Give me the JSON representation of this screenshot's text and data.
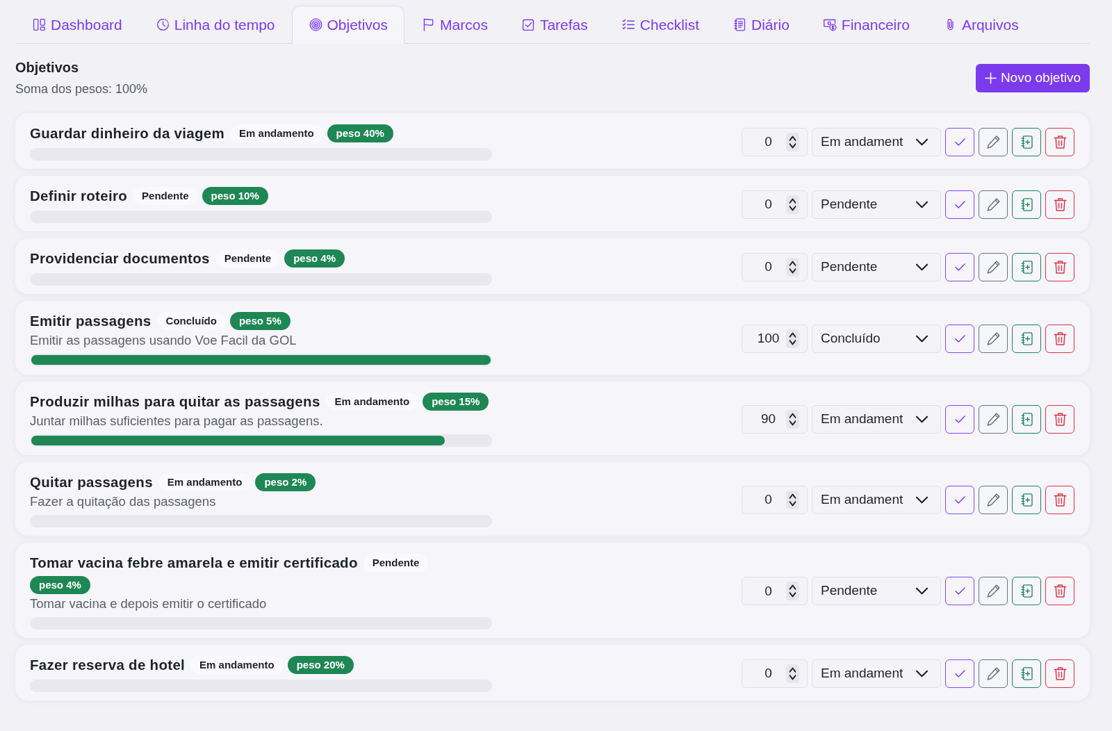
{
  "tabs": [
    {
      "label": "Dashboard",
      "selected": false
    },
    {
      "label": "Linha do tempo",
      "selected": false
    },
    {
      "label": "Objetivos",
      "selected": true
    },
    {
      "label": "Marcos",
      "selected": false
    },
    {
      "label": "Tarefas",
      "selected": false
    },
    {
      "label": "Checklist",
      "selected": false
    },
    {
      "label": "Diário",
      "selected": false
    },
    {
      "label": "Financeiro",
      "selected": false
    },
    {
      "label": "Arquivos",
      "selected": false
    }
  ],
  "header": {
    "title": "Objetivos",
    "subtitle": "Soma dos pesos: 100%",
    "button": "Novo objetivo"
  },
  "objectives": [
    {
      "title": "Guardar dinheiro da viagem",
      "status": "Em andamento",
      "weight": "peso 40%",
      "level": 0,
      "progress": "0",
      "status_select": "Em andament"
    },
    {
      "title": "Definir roteiro",
      "status": "Pendente",
      "weight": "peso 10%",
      "level": 0,
      "progress": "0",
      "status_select": "Pendente"
    },
    {
      "title": "Providenciar documentos",
      "status": "Pendente",
      "weight": "peso 4%",
      "level": 0,
      "progress": "0",
      "status_select": "Pendente"
    },
    {
      "title": "Emitir passagens",
      "status": "Concluído",
      "weight": "peso 5%",
      "description": "Emitir as passagens usando Voe Facil da GOL",
      "level": 1,
      "progress": "100",
      "status_select": "Concluído"
    },
    {
      "title": "Produzir milhas para quitar as passagens",
      "status": "Em andamento",
      "weight": "peso 15%",
      "description": "Juntar milhas suficientes para pagar as passagens.",
      "level": 0.9,
      "progress": "90",
      "status_select": "Em andament"
    },
    {
      "title": "Quitar passagens",
      "status": "Em andamento",
      "weight": "peso 2%",
      "description": "Fazer a quitação das passagens",
      "level": 0,
      "progress": "0",
      "status_select": "Em andament"
    },
    {
      "title": "Tomar vacina febre amarela e emitir certificado",
      "status": "Pendente",
      "weight": "peso 4%",
      "description": "Tomar vacina e depois emitir o certificado",
      "level": 0,
      "progress": "0",
      "status_select": "Pendente"
    },
    {
      "title": "Fazer reserva de hotel",
      "status": "Em andamento",
      "weight": "peso 20%",
      "level": 0,
      "progress": "0",
      "status_select": "Em andament"
    }
  ]
}
